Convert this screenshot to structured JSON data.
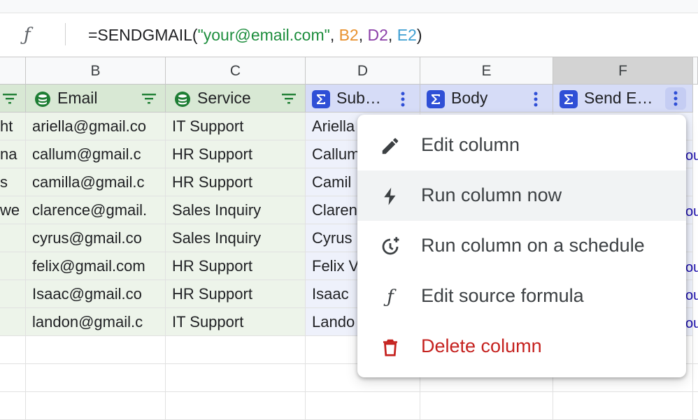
{
  "formula": {
    "fx": "ƒ",
    "prefix": "=SENDGMAIL(",
    "string_arg": "\"your@email.com\"",
    "sep1": ", ",
    "ref_b2": "B2",
    "sep2": ", ",
    "ref_d2": "D2",
    "sep3": ", ",
    "ref_e2": "E2",
    "suffix": ")"
  },
  "columns": [
    "B",
    "C",
    "D",
    "E",
    "F"
  ],
  "header_row": {
    "email": "Email",
    "service": "Service",
    "subject": "Sub…",
    "body": "Body",
    "send": "Send E…"
  },
  "rows": [
    {
      "a": "ht",
      "email": "ariella@gmail.co",
      "service": "IT Support",
      "subject": "Ariella"
    },
    {
      "a": "na",
      "email": "callum@gmail.c",
      "service": "HR Support",
      "subject": "Callum"
    },
    {
      "a": "s",
      "email": "camilla@gmail.c",
      "service": "HR Support",
      "subject": "Camil"
    },
    {
      "a": "we",
      "email": "clarence@gmail.",
      "service": "Sales Inquiry",
      "subject": "Claren"
    },
    {
      "a": "",
      "email": "cyrus@gmail.co",
      "service": "Sales Inquiry",
      "subject": "Cyrus"
    },
    {
      "a": "",
      "email": "felix@gmail.com",
      "service": "HR Support",
      "subject": "Felix V"
    },
    {
      "a": "",
      "email": "Isaac@gmail.co",
      "service": "HR Support",
      "subject": "Isaac"
    },
    {
      "a": "",
      "email": "landon@gmail.c",
      "service": "IT Support",
      "subject": "Lando"
    }
  ],
  "menu": {
    "edit": "Edit column",
    "run_now": "Run column now",
    "schedule": "Run column on a schedule",
    "edit_formula": "Edit source formula",
    "delete": "Delete column"
  },
  "colors": {
    "source_header": "#d8e8d4",
    "formula_header": "#d6dcf7",
    "danger": "#c5221f"
  },
  "icons": {
    "source_column": "database-icon",
    "formula_column": "sigma-icon",
    "filter": "filter-icon",
    "more": "more-vert-icon"
  }
}
